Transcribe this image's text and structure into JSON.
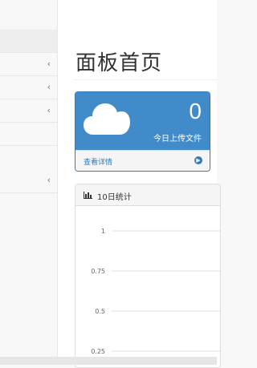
{
  "sidebar": {
    "items": [
      {
        "has_chevron": true,
        "chevron": "‹"
      },
      {
        "has_chevron": true,
        "chevron": "‹"
      },
      {
        "has_chevron": true,
        "chevron": "‹"
      },
      {
        "has_chevron": false,
        "chevron": ""
      },
      {
        "has_chevron": true,
        "chevron": "‹"
      }
    ]
  },
  "main": {
    "page_title": "面板首页",
    "upload_panel": {
      "count": "0",
      "caption": "今日上传文件",
      "details_link": "查看详情",
      "icon": "cloud-icon",
      "footer_icon": "arrow-circle-right-icon",
      "color": "#428bca"
    },
    "stats_panel": {
      "title": "10日统计",
      "icon": "bar-chart-icon"
    }
  },
  "chart_data": {
    "type": "line",
    "y_ticks": [
      "1",
      "0.75",
      "0.5",
      "0.25"
    ],
    "ylim": [
      0,
      1
    ],
    "grid": true,
    "series": []
  }
}
